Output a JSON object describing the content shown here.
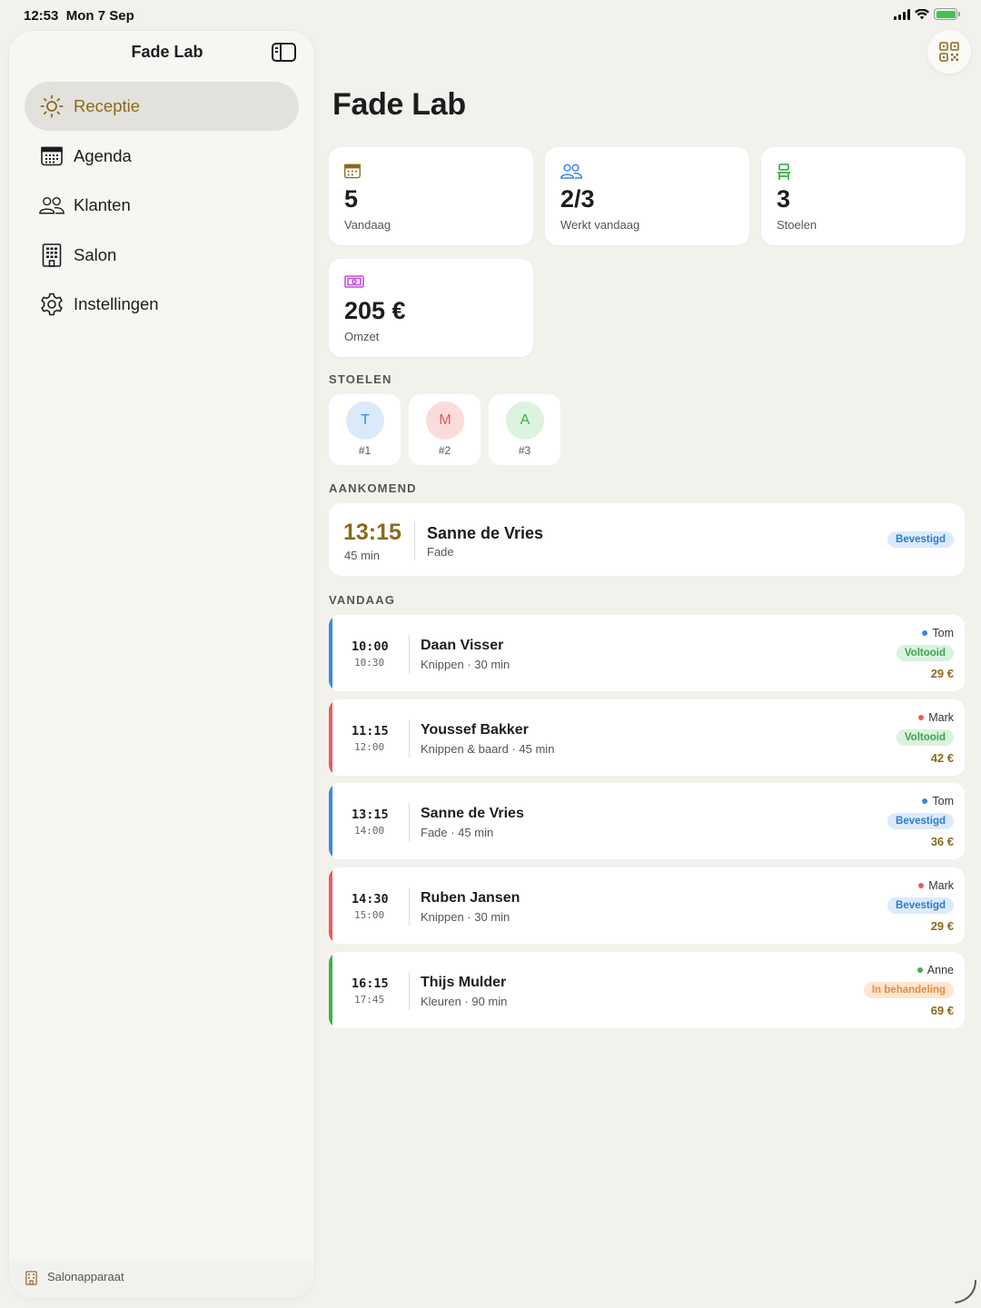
{
  "status_bar": {
    "time": "12:53",
    "date": "Mon 7 Sep"
  },
  "sidebar": {
    "title": "Fade Lab",
    "items": [
      {
        "label": "Receptie",
        "icon": "sun-icon",
        "active": true
      },
      {
        "label": "Agenda",
        "icon": "calendar-icon",
        "active": false
      },
      {
        "label": "Klanten",
        "icon": "people-icon",
        "active": false
      },
      {
        "label": "Salon",
        "icon": "building-icon",
        "active": false
      },
      {
        "label": "Instellingen",
        "icon": "gear-icon",
        "active": false
      }
    ],
    "footer_label": "Salonapparaat"
  },
  "main": {
    "title": "Fade Lab",
    "stats": [
      {
        "value": "5",
        "label": "Vandaag",
        "icon": "calendar-icon",
        "color": "#8a6a1c"
      },
      {
        "value": "2/3",
        "label": "Werkt vandaag",
        "icon": "people-icon",
        "color": "#3a86e8"
      },
      {
        "value": "3",
        "label": "Stoelen",
        "icon": "chair-icon",
        "color": "#3bb34a"
      },
      {
        "value": "205 €",
        "label": "Omzet",
        "icon": "cash-icon",
        "color": "#c44fd6"
      }
    ],
    "sections": {
      "chairs": "STOELEN",
      "upcoming": "AANKOMEND",
      "today": "VANDAAG"
    },
    "chairs": [
      {
        "initial": "T",
        "number": "#1",
        "bg": "#dbeaf9",
        "fg": "#3a86e8"
      },
      {
        "initial": "M",
        "number": "#2",
        "bg": "#fbdcdc",
        "fg": "#e25656"
      },
      {
        "initial": "A",
        "number": "#3",
        "bg": "#dcf3df",
        "fg": "#3bb34a"
      }
    ],
    "upcoming": {
      "time": "13:15",
      "duration": "45 min",
      "name": "Sanne de Vries",
      "service": "Fade",
      "status": "Bevestigd"
    },
    "appointments": [
      {
        "start": "10:00",
        "end": "10:30",
        "name": "Daan Visser",
        "service": "Knippen · 30 min",
        "staff": "Tom",
        "status": "Voltooid",
        "price": "29 €",
        "color": "#3a86e8",
        "status_color": "green"
      },
      {
        "start": "11:15",
        "end": "12:00",
        "name": "Youssef Bakker",
        "service": "Knippen & baard · 45 min",
        "staff": "Mark",
        "status": "Voltooid",
        "price": "42 €",
        "color": "#e85d5d",
        "status_color": "green"
      },
      {
        "start": "13:15",
        "end": "14:00",
        "name": "Sanne de Vries",
        "service": "Fade · 45 min",
        "staff": "Tom",
        "status": "Bevestigd",
        "price": "36 €",
        "color": "#3a86e8",
        "status_color": "blue"
      },
      {
        "start": "14:30",
        "end": "15:00",
        "name": "Ruben Jansen",
        "service": "Knippen · 30 min",
        "staff": "Mark",
        "status": "Bevestigd",
        "price": "29 €",
        "color": "#e85d5d",
        "status_color": "blue"
      },
      {
        "start": "16:15",
        "end": "17:45",
        "name": "Thijs Mulder",
        "service": "Kleuren · 90 min",
        "staff": "Anne",
        "status": "In behandeling",
        "price": "69 €",
        "color": "#3bb34a",
        "status_color": "orange"
      }
    ]
  },
  "colors": {
    "accent": "#8a6a1c",
    "background": "#f3f1ec"
  }
}
